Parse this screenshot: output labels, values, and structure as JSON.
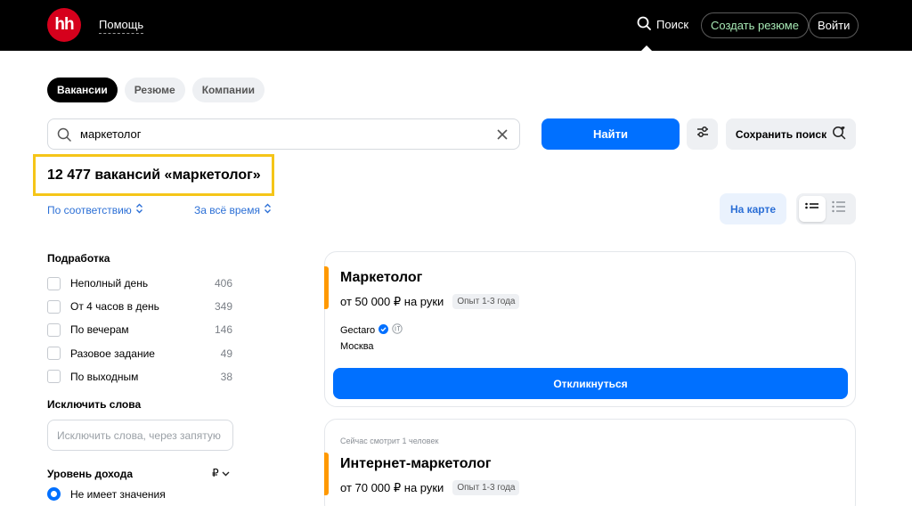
{
  "header": {
    "logo_text": "hh",
    "help": "Помощь",
    "search": "Поиск",
    "create_resume": "Создать резюме",
    "login": "Войти"
  },
  "tabs": [
    {
      "label": "Вакансии",
      "active": true
    },
    {
      "label": "Резюме",
      "active": false
    },
    {
      "label": "Компании",
      "active": false
    }
  ],
  "search": {
    "value": "маркетолог",
    "find_label": "Найти",
    "save_label": "Сохранить поиск"
  },
  "results": {
    "title": "12 477 вакансий «маркетолог»"
  },
  "sort": {
    "relevance": "По соответствию",
    "period": "За всё время",
    "map": "На карте"
  },
  "sidebar": {
    "part_time": {
      "heading": "Подработка",
      "items": [
        {
          "label": "Неполный день",
          "count": "406"
        },
        {
          "label": "От 4 часов в день",
          "count": "349"
        },
        {
          "label": "По вечерам",
          "count": "146"
        },
        {
          "label": "Разовое задание",
          "count": "49"
        },
        {
          "label": "По выходным",
          "count": "38"
        }
      ]
    },
    "exclude": {
      "heading": "Исключить слова",
      "placeholder": "Исключить слова, через запятую"
    },
    "income": {
      "heading": "Уровень дохода",
      "currency": "₽",
      "option": "Не имеет значения"
    }
  },
  "vacancies": [
    {
      "title": "Маркетолог",
      "salary": "от 50 000 ₽ на руки",
      "experience": "Опыт 1-3 года",
      "company": "Gectaro",
      "city": "Москва",
      "respond": "Откликнуться"
    },
    {
      "viewing": "Сейчас смотрит 1 человек",
      "title": "Интернет-маркетолог",
      "salary": "от 70 000 ₽ на руки",
      "experience": "Опыт 1-3 года"
    }
  ],
  "colors": {
    "brand_red": "#d6001c",
    "primary_blue": "#0070ff",
    "highlight_yellow": "#f5c518",
    "accent_orange": "#ff9900"
  }
}
